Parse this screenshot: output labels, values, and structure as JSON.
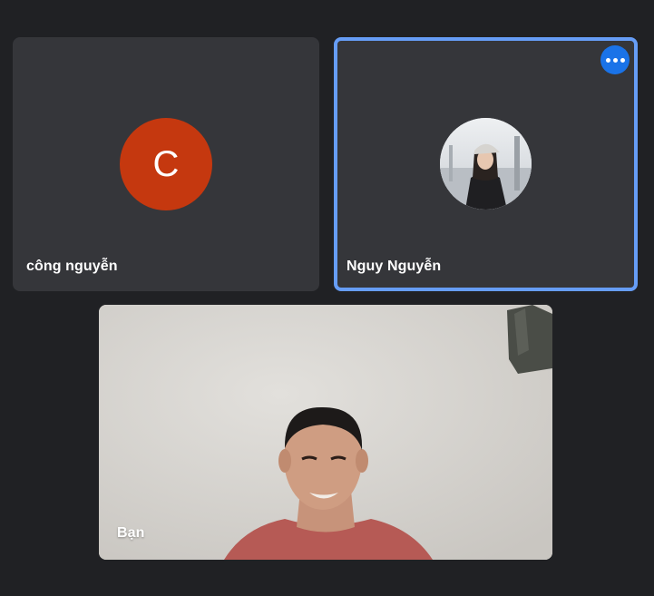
{
  "participants": [
    {
      "name": "công nguyễn",
      "avatar_letter": "C",
      "avatar_color": "#c5380f"
    },
    {
      "name": "Nguy Nguyễn",
      "active_speaker_border": "#669df6",
      "more_options_icon": "more-horiz-icon"
    },
    {
      "name": "Bạn"
    }
  ],
  "colors": {
    "background": "#202124",
    "tile": "#35363a",
    "accent": "#1a73e8"
  }
}
